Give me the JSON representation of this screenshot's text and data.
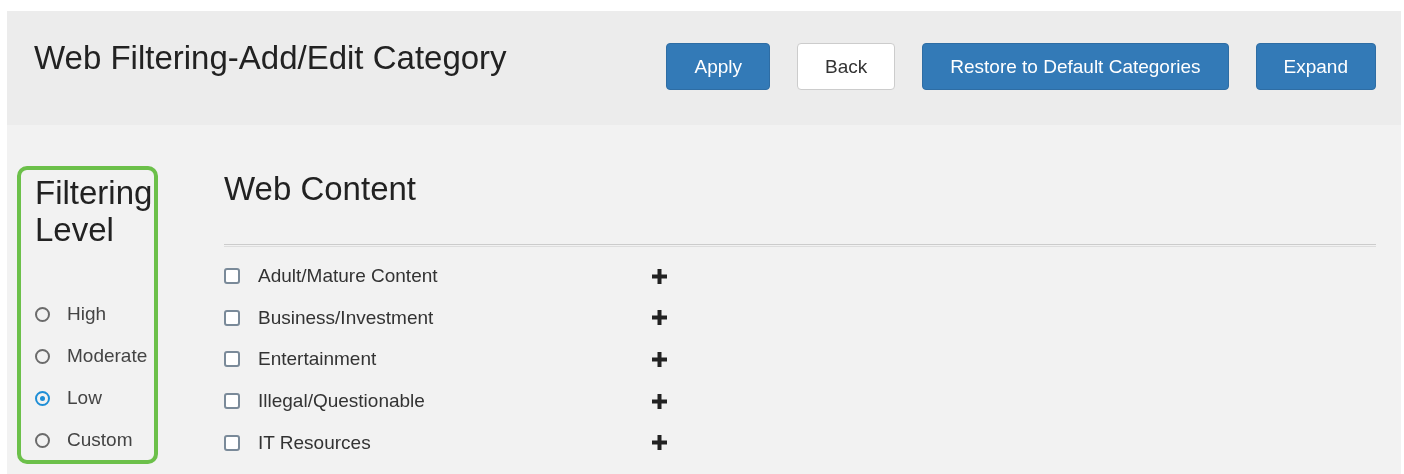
{
  "header": {
    "title": "Web Filtering-Add/Edit Category",
    "buttons": [
      {
        "label": "Apply",
        "kind": "primary"
      },
      {
        "label": "Back",
        "kind": "default"
      },
      {
        "label": "Restore to Default Categories",
        "kind": "primary"
      },
      {
        "label": "Expand",
        "kind": "primary"
      }
    ]
  },
  "filtering_level": {
    "title": "Filtering Level",
    "highlighted": true,
    "options": [
      {
        "label": "High",
        "selected": false
      },
      {
        "label": "Moderate",
        "selected": false
      },
      {
        "label": "Low",
        "selected": true
      },
      {
        "label": "Custom",
        "selected": false
      }
    ]
  },
  "web_content": {
    "title": "Web Content",
    "categories": [
      {
        "label": "Adult/Mature Content",
        "checked": false
      },
      {
        "label": "Business/Investment",
        "checked": false
      },
      {
        "label": "Entertainment",
        "checked": false
      },
      {
        "label": "Illegal/Questionable",
        "checked": false
      },
      {
        "label": "IT Resources",
        "checked": false
      }
    ]
  }
}
